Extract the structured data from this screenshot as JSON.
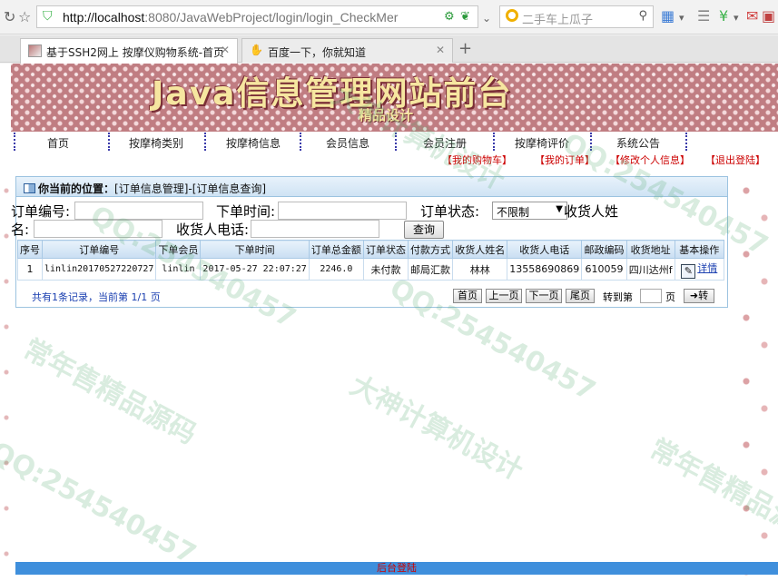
{
  "browser": {
    "url_host": "http://localhost",
    "url_rest": ":8080/JavaWebProject/login/login_CheckMer",
    "search_placeholder": "二手车上瓜子",
    "tabs": [
      {
        "label": "基于SSH2网上 按摩仪购物系统-首页",
        "active": true
      },
      {
        "label": "百度一下，你就知道",
        "active": false
      }
    ],
    "new_tab_label": "+"
  },
  "banner": {
    "title": "Java信息管理网站前台",
    "subtitle": "精品设计"
  },
  "nav": {
    "items": [
      "首页",
      "按摩椅类别",
      "按摩椅信息",
      "会员信息",
      "会员注册",
      "按摩椅评价",
      "系统公告"
    ]
  },
  "user_links": [
    "【我的购物车】",
    "【我的订单】",
    "【修改个人信息】",
    "【退出登陆】"
  ],
  "panel": {
    "location_label": "你当前的位置：",
    "location_path": "[订单信息管理]-[订单信息查询]"
  },
  "form": {
    "order_no_label": "订单编号:",
    "order_time_label": "下单时间:",
    "order_status_label": "订单状态:",
    "order_status_value": "不限制",
    "receiver_name_label_a": "收货人姓",
    "receiver_name_label_b": "名:",
    "receiver_phone_label": "收货人电话:",
    "query_button": "查询"
  },
  "table": {
    "headers": [
      "序号",
      "订单编号",
      "下单会员",
      "下单时间",
      "订单总金额",
      "订单状态",
      "付款方式",
      "收货人姓名",
      "收货人电话",
      "邮政编码",
      "收货地址",
      "基本操作"
    ],
    "rows": [
      [
        "1",
        "linlin20170527220727",
        "linlin",
        "2017-05-27 22:07:27",
        "2246.0",
        "未付款",
        "邮局汇款",
        "林林",
        "13558690869",
        "610059",
        "四川达州f"
      ]
    ],
    "detail_link": "详情"
  },
  "pager": {
    "info": "共有1条记录，当前第 1/1 页",
    "first": "首页",
    "prev": "上一页",
    "next": "下一页",
    "last": "尾页",
    "goto_label": "转到第",
    "page_unit": "页",
    "go_button": "➜转"
  },
  "footer": {
    "admin_link": "后台登陆"
  },
  "watermarks": [
    "QQ:254540457",
    "常年售精品源码",
    "大神计算机设计",
    "QQ:254540457",
    "QQ:254540457",
    "常年售精品源码",
    "大神计算机设计",
    "QQ:254540457"
  ],
  "colors": {
    "nav_red": "#cc0000",
    "link_blue": "#1a3fb0",
    "header_blue": "#c9def2",
    "footer_blue": "#3f8fdc",
    "banner_rose": "#c07d82",
    "banner_gold": "#f6e6a0"
  }
}
